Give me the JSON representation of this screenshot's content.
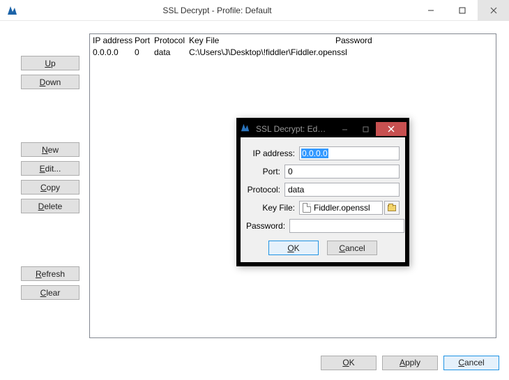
{
  "window": {
    "title": "SSL Decrypt - Profile: Default"
  },
  "sidebar": {
    "up": "Up",
    "down": "Down",
    "new": "New",
    "edit": "Edit...",
    "copy": "Copy",
    "delete": "Delete",
    "refresh": "Refresh",
    "clear": "Clear"
  },
  "grid": {
    "headers": {
      "ip": "IP address",
      "port": "Port",
      "protocol": "Protocol",
      "keyfile": "Key File",
      "password": "Password"
    },
    "rows": [
      {
        "ip": "0.0.0.0",
        "port": "0",
        "protocol": "data",
        "keyfile": "C:\\Users\\J\\Desktop\\!fiddler\\Fiddler.openssl",
        "password": ""
      }
    ]
  },
  "bottom": {
    "ok": "OK",
    "apply": "Apply",
    "cancel": "Cancel"
  },
  "modal": {
    "title": "SSL Decrypt: Ed…",
    "labels": {
      "ip": "IP address:",
      "port": "Port:",
      "protocol": "Protocol:",
      "keyfile": "Key File:",
      "password": "Password:"
    },
    "values": {
      "ip": "0.0.0.0",
      "port": "0",
      "protocol": "data",
      "keyfile": "Fiddler.openssl",
      "password": ""
    },
    "ok": "OK",
    "cancel": "Cancel"
  }
}
